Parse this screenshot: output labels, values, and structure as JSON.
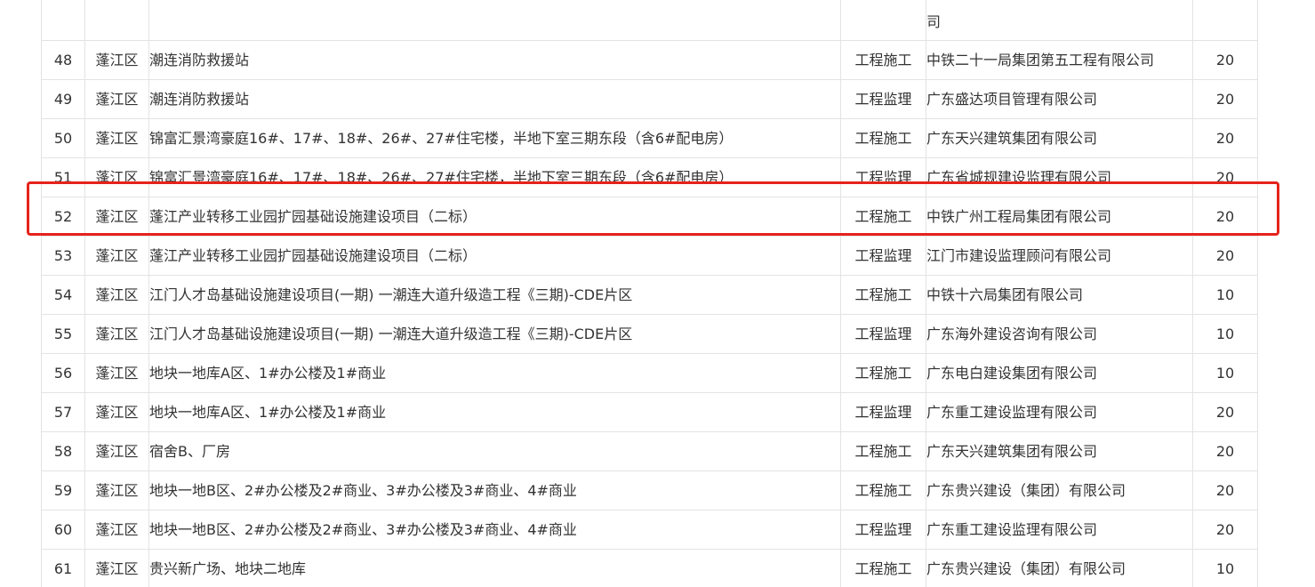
{
  "table": {
    "top_partial": {
      "no": "",
      "district": "",
      "project": "",
      "type": "",
      "company": "司",
      "score": ""
    },
    "rows": [
      {
        "no": "48",
        "district": "蓬江区",
        "project": "潮连消防救援站",
        "type": "工程施工",
        "company": "中铁二十一局集团第五工程有限公司",
        "score": "20"
      },
      {
        "no": "49",
        "district": "蓬江区",
        "project": "潮连消防救援站",
        "type": "工程监理",
        "company": "广东盛达项目管理有限公司",
        "score": "20"
      },
      {
        "no": "50",
        "district": "蓬江区",
        "project": "锦富汇景湾豪庭16#、17#、18#、26#、27#住宅楼，半地下室三期东段（含6#配电房）",
        "type": "工程施工",
        "company": "广东天兴建筑集团有限公司",
        "score": "20"
      },
      {
        "no": "51",
        "district": "蓬江区",
        "project": "锦富汇景湾豪庭16#、17#、18#、26#、27#住宅楼，半地下室三期东段（含6#配电房）",
        "type": "工程监理",
        "company": "广东省城规建设监理有限公司",
        "score": "20"
      },
      {
        "no": "52",
        "district": "蓬江区",
        "project": "蓬江产业转移工业园扩园基础设施建设项目（二标）",
        "type": "工程施工",
        "company": "中铁广州工程局集团有限公司",
        "score": "20"
      },
      {
        "no": "53",
        "district": "蓬江区",
        "project": "蓬江产业转移工业园扩园基础设施建设项目（二标）",
        "type": "工程监理",
        "company": "江门市建设监理顾问有限公司",
        "score": "20"
      },
      {
        "no": "54",
        "district": "蓬江区",
        "project": "江门人才岛基础设施建设项目(一期) 一潮连大道升级造工程《三期)-CDE片区",
        "type": "工程施工",
        "company": "中铁十六局集团有限公司",
        "score": "10"
      },
      {
        "no": "55",
        "district": "蓬江区",
        "project": "江门人才岛基础设施建设项目(一期) 一潮连大道升级造工程《三期)-CDE片区",
        "type": "工程监理",
        "company": "广东海外建设咨询有限公司",
        "score": "10"
      },
      {
        "no": "56",
        "district": "蓬江区",
        "project": "地块一地库A区、1#办公楼及1#商业",
        "type": "工程施工",
        "company": "广东电白建设集团有限公司",
        "score": "10"
      },
      {
        "no": "57",
        "district": "蓬江区",
        "project": "地块一地库A区、1#办公楼及1#商业",
        "type": "工程监理",
        "company": "广东重工建设监理有限公司",
        "score": "20"
      },
      {
        "no": "58",
        "district": "蓬江区",
        "project": "宿舍B、厂房",
        "type": "工程施工",
        "company": "广东天兴建筑集团有限公司",
        "score": "20"
      },
      {
        "no": "59",
        "district": "蓬江区",
        "project": "地块一地B区、2#办公楼及2#商业、3#办公楼及3#商业、4#商业",
        "type": "工程施工",
        "company": "广东贵兴建设（集团）有限公司",
        "score": "20"
      },
      {
        "no": "60",
        "district": "蓬江区",
        "project": "地块一地B区、2#办公楼及2#商业、3#办公楼及3#商业、4#商业",
        "type": "工程监理",
        "company": "广东重工建设监理有限公司",
        "score": "20"
      },
      {
        "no": "61",
        "district": "蓬江区",
        "project": "贵兴新广场、地块二地库",
        "type": "工程施工",
        "company": "广东贵兴建设（集团）有限公司",
        "score": "10"
      }
    ]
  },
  "highlight": {
    "row_no": "52",
    "color": "#e5231b"
  }
}
